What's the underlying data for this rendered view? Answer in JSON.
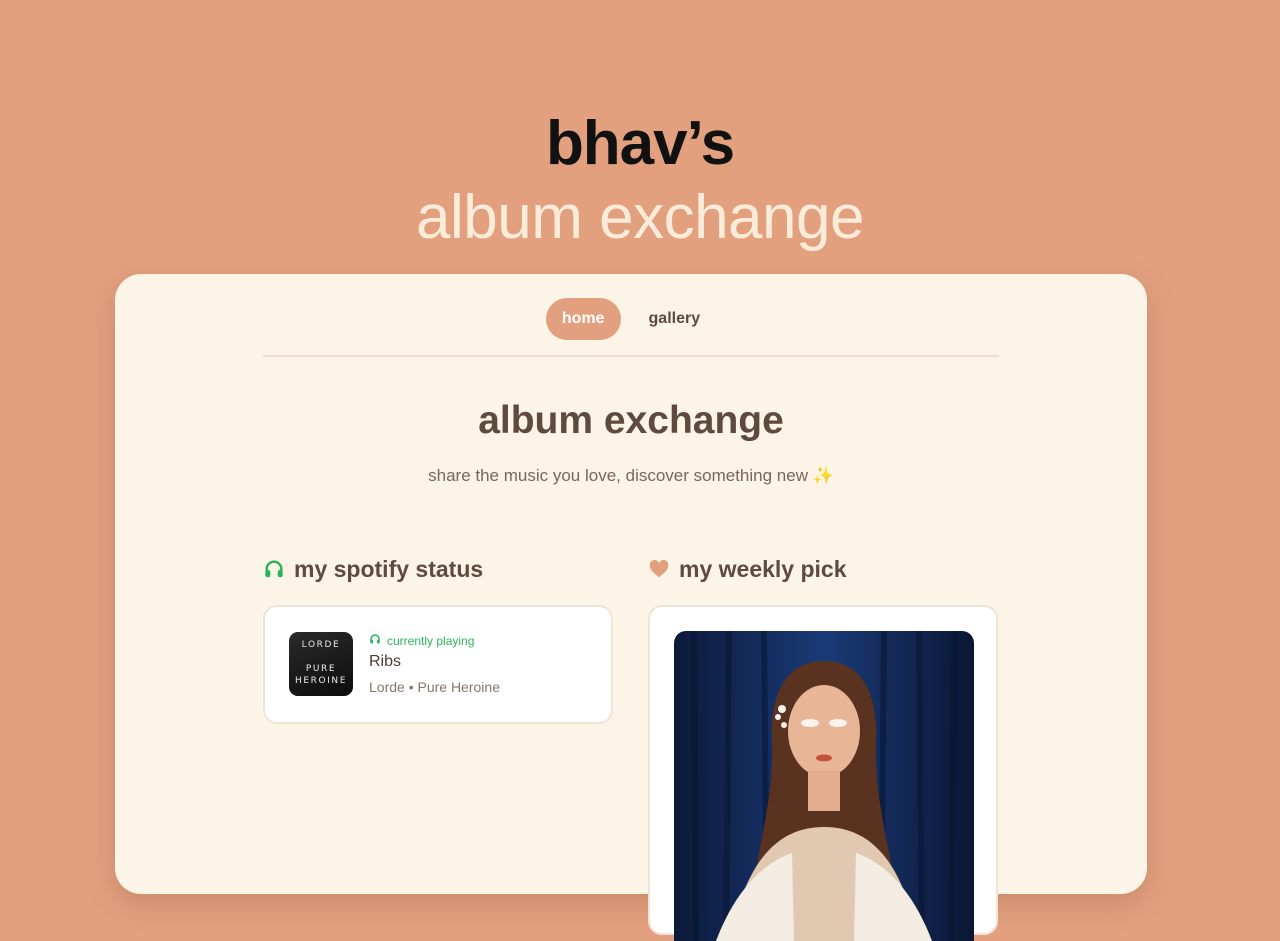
{
  "hero": {
    "line1": "bhav’s",
    "line2": "album exchange"
  },
  "nav": {
    "items": [
      {
        "label": "home",
        "active": true
      },
      {
        "label": "gallery",
        "active": false
      }
    ]
  },
  "page": {
    "title": "album exchange",
    "subtitle": "share the music you love, discover something new ✨"
  },
  "spotify": {
    "heading": "my spotify status",
    "icon": "headphones-icon",
    "status_label": "currently playing",
    "track": "Ribs",
    "meta": "Lorde • Pure Heroine",
    "album_art": {
      "line1": "LORDE",
      "line2": "PURE",
      "line3": "HEROINE"
    }
  },
  "weekly": {
    "heading": "my weekly pick",
    "icon": "heart-icon"
  },
  "colors": {
    "background": "#e2a07f",
    "card": "#fcf4e6",
    "accent": "#e2a07f",
    "spotify_green": "#2bb35a",
    "text_dark": "#5e4a3e"
  }
}
